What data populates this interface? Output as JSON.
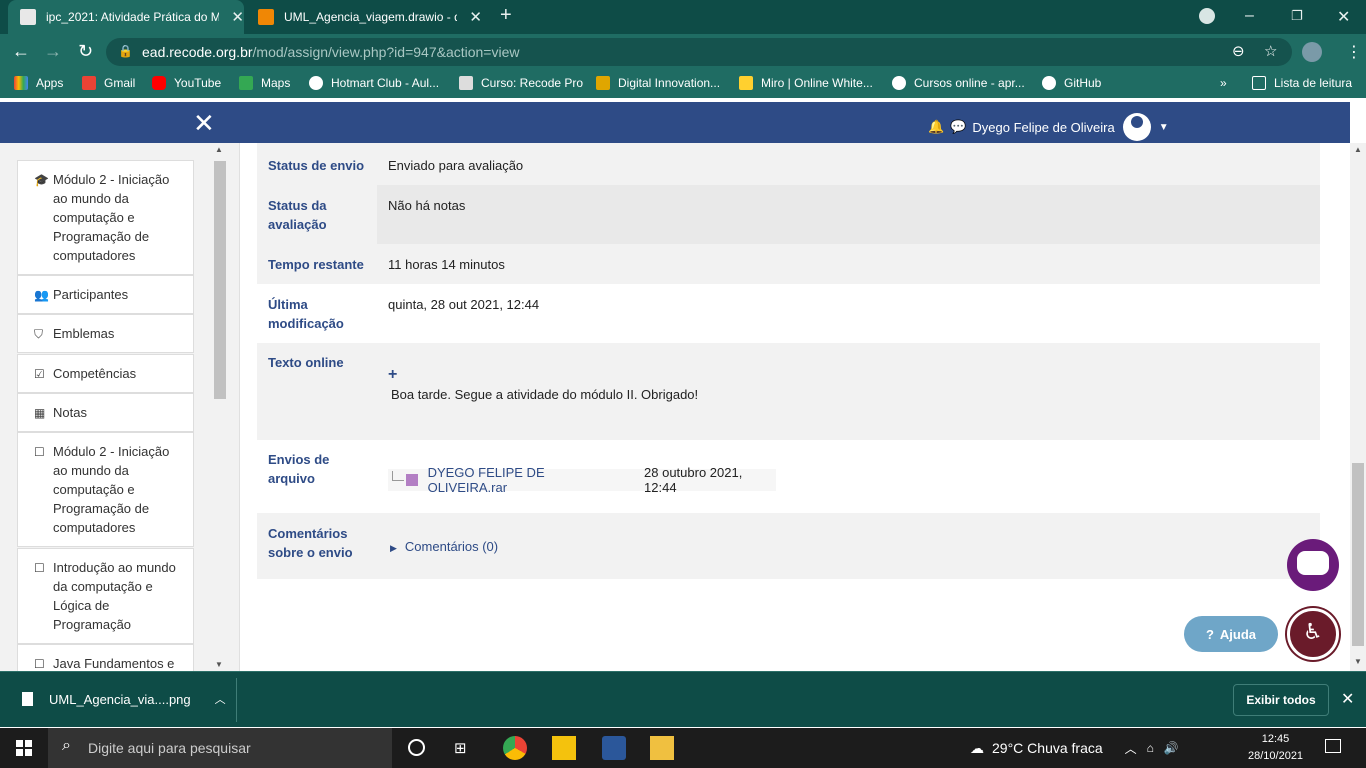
{
  "browser": {
    "tabs": [
      {
        "title": "ipc_2021: Atividade Prática do M",
        "active": true
      },
      {
        "title": "UML_Agencia_viagem.drawio - d",
        "active": false
      }
    ],
    "url_host": "ead.recode.org.br",
    "url_path": "/mod/assign/view.php?id=947&action=view",
    "bookmarks": [
      "Apps",
      "Gmail",
      "YouTube",
      "Maps",
      "Hotmart Club - Aul...",
      "Curso: Recode Pro",
      "Digital Innovation...",
      "Miro | Online White...",
      "Cursos online - apr...",
      "GitHub"
    ],
    "reading_list": "Lista de leitura"
  },
  "navbar": {
    "user_name": "Dyego Felipe de Oliveira"
  },
  "sidebar": {
    "items": [
      {
        "label": "Módulo 2 - Iniciação ao mundo da computação e Programação de computadores",
        "icon": "graduation-cap-icon"
      },
      {
        "label": "Participantes",
        "icon": "users-icon"
      },
      {
        "label": "Emblemas",
        "icon": "shield-icon"
      },
      {
        "label": "Competências",
        "icon": "check-square-icon"
      },
      {
        "label": "Notas",
        "icon": "table-icon"
      },
      {
        "label": "Módulo 2 - Iniciação ao mundo da computação e Programação de computadores",
        "icon": "folder-icon"
      },
      {
        "label": "Introdução ao mundo da computação e Lógica de Programação",
        "icon": "folder-icon"
      },
      {
        "label": "Java Fundamentos e",
        "icon": "folder-icon"
      }
    ]
  },
  "submission": {
    "status_envio": {
      "label": "Status de envio",
      "value": "Enviado para avaliação"
    },
    "status_avaliacao": {
      "label": "Status da avaliação",
      "value": "Não há notas"
    },
    "tempo": {
      "label": "Tempo restante",
      "value": "11 horas 14 minutos"
    },
    "ultima_mod": {
      "label": "Última modificação",
      "value": "quinta, 28 out 2021, 12:44"
    },
    "texto_online": {
      "label": "Texto online",
      "expand": "+",
      "value": "Boa tarde. Segue a atividade do módulo II. Obrigado!"
    },
    "envios": {
      "label": "Envios de arquivo",
      "file": "DYEGO FELIPE DE OLIVEIRA.rar",
      "date": "28 outubro 2021, 12:44"
    },
    "comentarios": {
      "label": "Comentários sobre o envio",
      "link": "Comentários (0)"
    }
  },
  "help_label": "Ajuda",
  "downloads": {
    "file": "UML_Agencia_via....png",
    "show_all": "Exibir todos"
  },
  "taskbar": {
    "search_placeholder": "Digite aqui para pesquisar",
    "weather": "29°C  Chuva fraca",
    "time": "12:45",
    "date": "28/10/2021"
  },
  "colors": {
    "chrome_dark": "#0e4c47",
    "chrome_mid": "#1f6c63",
    "moodle_navbar": "#2e4b86",
    "label_blue": "#2e4b86",
    "purple": "#6a1b7a"
  }
}
